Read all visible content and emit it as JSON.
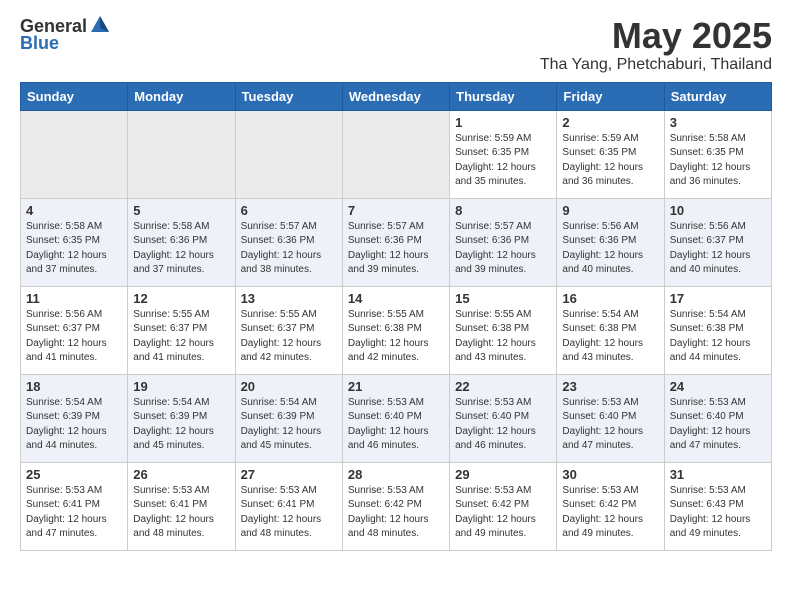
{
  "header": {
    "logo_general": "General",
    "logo_blue": "Blue",
    "month_title": "May 2025",
    "location": "Tha Yang, Phetchaburi, Thailand"
  },
  "weekdays": [
    "Sunday",
    "Monday",
    "Tuesday",
    "Wednesday",
    "Thursday",
    "Friday",
    "Saturday"
  ],
  "weeks": [
    [
      {
        "day": "",
        "info": ""
      },
      {
        "day": "",
        "info": ""
      },
      {
        "day": "",
        "info": ""
      },
      {
        "day": "",
        "info": ""
      },
      {
        "day": "1",
        "info": "Sunrise: 5:59 AM\nSunset: 6:35 PM\nDaylight: 12 hours\nand 35 minutes."
      },
      {
        "day": "2",
        "info": "Sunrise: 5:59 AM\nSunset: 6:35 PM\nDaylight: 12 hours\nand 36 minutes."
      },
      {
        "day": "3",
        "info": "Sunrise: 5:58 AM\nSunset: 6:35 PM\nDaylight: 12 hours\nand 36 minutes."
      }
    ],
    [
      {
        "day": "4",
        "info": "Sunrise: 5:58 AM\nSunset: 6:35 PM\nDaylight: 12 hours\nand 37 minutes."
      },
      {
        "day": "5",
        "info": "Sunrise: 5:58 AM\nSunset: 6:36 PM\nDaylight: 12 hours\nand 37 minutes."
      },
      {
        "day": "6",
        "info": "Sunrise: 5:57 AM\nSunset: 6:36 PM\nDaylight: 12 hours\nand 38 minutes."
      },
      {
        "day": "7",
        "info": "Sunrise: 5:57 AM\nSunset: 6:36 PM\nDaylight: 12 hours\nand 39 minutes."
      },
      {
        "day": "8",
        "info": "Sunrise: 5:57 AM\nSunset: 6:36 PM\nDaylight: 12 hours\nand 39 minutes."
      },
      {
        "day": "9",
        "info": "Sunrise: 5:56 AM\nSunset: 6:36 PM\nDaylight: 12 hours\nand 40 minutes."
      },
      {
        "day": "10",
        "info": "Sunrise: 5:56 AM\nSunset: 6:37 PM\nDaylight: 12 hours\nand 40 minutes."
      }
    ],
    [
      {
        "day": "11",
        "info": "Sunrise: 5:56 AM\nSunset: 6:37 PM\nDaylight: 12 hours\nand 41 minutes."
      },
      {
        "day": "12",
        "info": "Sunrise: 5:55 AM\nSunset: 6:37 PM\nDaylight: 12 hours\nand 41 minutes."
      },
      {
        "day": "13",
        "info": "Sunrise: 5:55 AM\nSunset: 6:37 PM\nDaylight: 12 hours\nand 42 minutes."
      },
      {
        "day": "14",
        "info": "Sunrise: 5:55 AM\nSunset: 6:38 PM\nDaylight: 12 hours\nand 42 minutes."
      },
      {
        "day": "15",
        "info": "Sunrise: 5:55 AM\nSunset: 6:38 PM\nDaylight: 12 hours\nand 43 minutes."
      },
      {
        "day": "16",
        "info": "Sunrise: 5:54 AM\nSunset: 6:38 PM\nDaylight: 12 hours\nand 43 minutes."
      },
      {
        "day": "17",
        "info": "Sunrise: 5:54 AM\nSunset: 6:38 PM\nDaylight: 12 hours\nand 44 minutes."
      }
    ],
    [
      {
        "day": "18",
        "info": "Sunrise: 5:54 AM\nSunset: 6:39 PM\nDaylight: 12 hours\nand 44 minutes."
      },
      {
        "day": "19",
        "info": "Sunrise: 5:54 AM\nSunset: 6:39 PM\nDaylight: 12 hours\nand 45 minutes."
      },
      {
        "day": "20",
        "info": "Sunrise: 5:54 AM\nSunset: 6:39 PM\nDaylight: 12 hours\nand 45 minutes."
      },
      {
        "day": "21",
        "info": "Sunrise: 5:53 AM\nSunset: 6:40 PM\nDaylight: 12 hours\nand 46 minutes."
      },
      {
        "day": "22",
        "info": "Sunrise: 5:53 AM\nSunset: 6:40 PM\nDaylight: 12 hours\nand 46 minutes."
      },
      {
        "day": "23",
        "info": "Sunrise: 5:53 AM\nSunset: 6:40 PM\nDaylight: 12 hours\nand 47 minutes."
      },
      {
        "day": "24",
        "info": "Sunrise: 5:53 AM\nSunset: 6:40 PM\nDaylight: 12 hours\nand 47 minutes."
      }
    ],
    [
      {
        "day": "25",
        "info": "Sunrise: 5:53 AM\nSunset: 6:41 PM\nDaylight: 12 hours\nand 47 minutes."
      },
      {
        "day": "26",
        "info": "Sunrise: 5:53 AM\nSunset: 6:41 PM\nDaylight: 12 hours\nand 48 minutes."
      },
      {
        "day": "27",
        "info": "Sunrise: 5:53 AM\nSunset: 6:41 PM\nDaylight: 12 hours\nand 48 minutes."
      },
      {
        "day": "28",
        "info": "Sunrise: 5:53 AM\nSunset: 6:42 PM\nDaylight: 12 hours\nand 48 minutes."
      },
      {
        "day": "29",
        "info": "Sunrise: 5:53 AM\nSunset: 6:42 PM\nDaylight: 12 hours\nand 49 minutes."
      },
      {
        "day": "30",
        "info": "Sunrise: 5:53 AM\nSunset: 6:42 PM\nDaylight: 12 hours\nand 49 minutes."
      },
      {
        "day": "31",
        "info": "Sunrise: 5:53 AM\nSunset: 6:43 PM\nDaylight: 12 hours\nand 49 minutes."
      }
    ]
  ]
}
